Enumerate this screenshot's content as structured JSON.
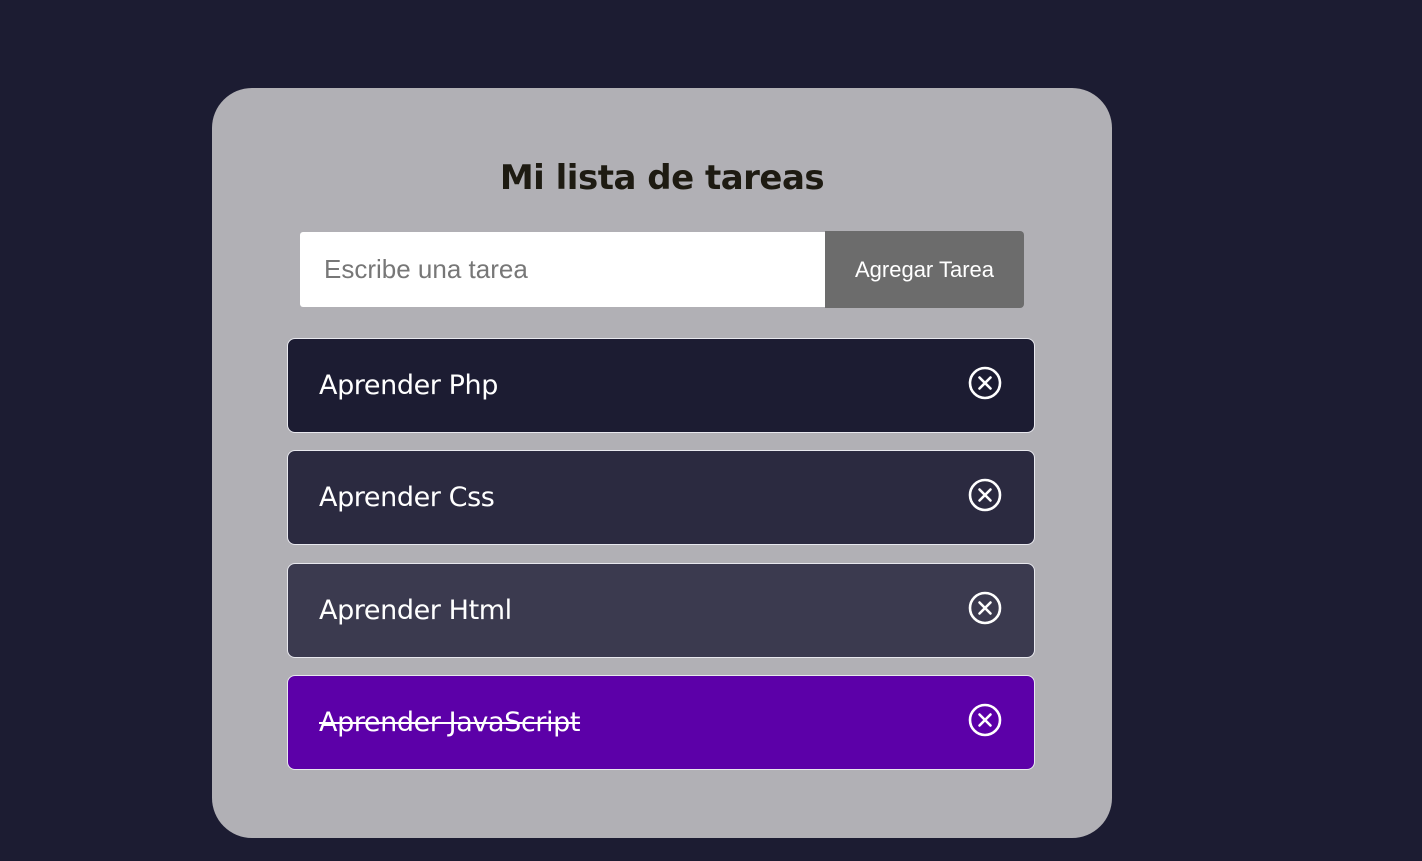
{
  "app": {
    "title": "Mi lista de tareas"
  },
  "form": {
    "input_placeholder": "Escribe una tarea",
    "input_value": "",
    "add_button_label": "Agregar Tarea"
  },
  "tasks": [
    {
      "text": "Aprender Php",
      "completed": false,
      "bg": "#1c1c32"
    },
    {
      "text": "Aprender Css",
      "completed": false,
      "bg": "#2b2a40"
    },
    {
      "text": "Aprender Html",
      "completed": false,
      "bg": "#3b3a4f"
    },
    {
      "text": "Aprender JavaScript",
      "completed": true,
      "bg": "#5c00a8"
    }
  ],
  "colors": {
    "page_background": "#1c1c32",
    "card_background": "#b1b0b5",
    "button_background": "#6c6c6c",
    "completed_task": "#5c00a8"
  },
  "icons": {
    "delete": "close-circle-icon"
  }
}
